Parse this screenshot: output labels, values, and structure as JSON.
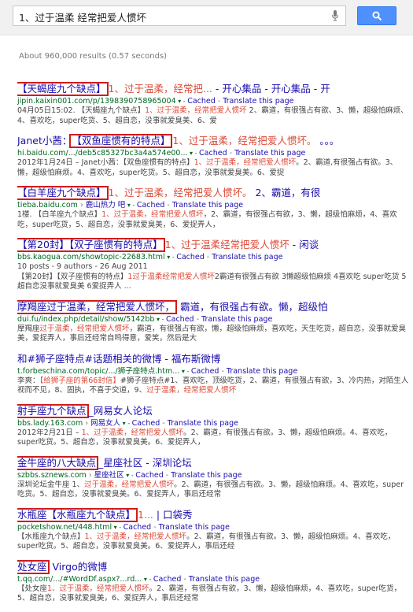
{
  "search": {
    "query": "1、过于温柔 经常把爱人惯坏"
  },
  "stats": "About 960,000 results (0.57 seconds)",
  "results": [
    {
      "title_hl": "【天蝎座九个缺点】",
      "title_red": "1、过于温柔，经常把...",
      "title_rest": " - 开心集品 - 开心集品 - 开",
      "url": "jipin.kaixin001.com/p/1398390758965004",
      "cached": "Cached",
      "translate": "Translate this page",
      "snippet": [
        [
          "04月05日15:02. 【天蝎座九个缺点】",
          "1、过于温柔，经常把爱人惯坏",
          " 2、霸道，有很强占有欲、3、懒，超级怕麻烦、4、喜欢吃，super吃货、5、超自恋，没事就爱臭美、6、爱"
        ]
      ]
    },
    {
      "title_pre": "Janet小茜：",
      "title_hl": "【双鱼座惯有的特点】",
      "title_red": "1、过于温柔，经常把爱人惯坏。",
      "title_rest": " 。。。",
      "url": "hi.baidu.com/.../deb5c85327bc3a4a574e00...",
      "cached": "Cached",
      "translate": "Translate this page",
      "snippet": [
        [
          "2012年1月24日 – Janet小茜：【双鱼座惯有的特点】",
          "1、过于温柔，经常把爱人惯坏",
          "。2、霸道,有很强占有欲。3、懒，超级怕麻烦。4、喜欢吃，super吃货。5、超自恋，没事就爱臭美。6、爱捉"
        ]
      ]
    },
    {
      "title_hl": "【白羊座九个缺点】",
      "title_red": "1、过于温柔，经常把爱人惯坏。",
      "title_rest": " 2、霸道，有很",
      "url": "tieba.baidu.com",
      "url_link": "鹿山热力 吧",
      "cached": "Cached",
      "translate": "Translate this page",
      "snippet": [
        [
          "1楼. 【白羊座九个缺点】",
          "1、过于温柔，经常把爱人惯坏",
          "，2、霸道，有很强占有欲，3、懒，超级怕麻烦，4、喜欢吃，super吃货，5、超自恋，没事就爱臭美，6、爱捉弄人，"
        ]
      ]
    },
    {
      "title_hl": "【第20封】【双子座惯有的特点】",
      "title_red": "1、过于温柔经常把爱人惯坏",
      "title_rest": " - 闲谈",
      "url": "bbs.kaogua.com/showtopic-22683.html",
      "cached": "Cached",
      "translate": "Translate this page",
      "meta": "10 posts - 9 authors - 26 Aug 2011",
      "snippet": [
        [
          "【第20封】【双子座惯有的特点】",
          "1过于温柔经常把爱人惯坏",
          "2霸道有很强占有欲 3懒超级怕麻烦 4喜欢吃 super吃货 5超自恋没事就爱臭美 6爱捉弄人 ..."
        ]
      ]
    },
    {
      "title_hl": "摩羯座过于温柔，经常把爱人惯坏，",
      "title_red": "",
      "title_rest": " 霸道，有很强占有欲。懒，超级怕",
      "url": "dui.fu/index.php/detail/show/5142bb",
      "cached": "Cached",
      "translate": "Translate this page",
      "snippet": [
        [
          "摩羯座",
          "过于温柔，经常把爱人惯坏",
          "，霸道，有很强占有欲，懒，超级怕麻烦，喜欢吃，天生吃货，超自恋，没事就爱臭美，爱捉弄人，事后还经常自鸣得意，爱笑，然后是大"
        ]
      ]
    },
    {
      "title_pre": "和#狮子座特点#话题相关的微博 - 福布斯微博",
      "url": "t.forbeschina.com/topic/.../狮子座特点.htm...",
      "cached": "Cached",
      "translate": "Translate this page",
      "snippet": [
        [
          "李爽：",
          "【给狮子座的第66封信】",
          "#狮子座特点#1、喜欢吃，顶级吃货，2、霸道，有很强占有欲，3、冷内热，对陌生人视而不见，8、固执，不喜于交道，9、",
          "过于温柔，经常把爱人惯坏"
        ]
      ]
    },
    {
      "title_hl": "射手座九个缺点",
      "title_rest": "_网易女人论坛",
      "url": "bbs.lady.163.com",
      "url_link": "网易女人",
      "cached": "Cached",
      "translate": "Translate this page",
      "snippet": [
        [
          "2012年2月21日 – ",
          "1、过于温柔，经常把爱人惯坏",
          "。2、霸道，有很强占有欲。3、懒，超级怕麻烦。4、喜欢吃，super吃货。5、超自恋，没事就爱臭美。6、爱捉弄人，"
        ]
      ]
    },
    {
      "title_hl": "金牛座的八大缺点",
      "title_rest": "_星座社区 - 深圳论坛",
      "url": "szbbs.sznews.com",
      "url_link": "星座社区",
      "cached": "Cached",
      "translate": "Translate this page",
      "snippet": [
        [
          "深圳论坛金牛座 1、",
          "过于温柔，经常把爱人惯坏",
          "。2、霸道，有很强占有欲。3、懒，超级怕麻烦。4、喜欢吃，super吃货。5、超自恋，没事就爱臭美。6、爱捉弄人，事后还经常"
        ]
      ]
    },
    {
      "title_hl": "水瓶座【水瓶座九个缺点】",
      "title_red": "1...",
      "title_rest": " | 口袋秀",
      "url": "pocketshow.net/448.html",
      "cached": "Cached",
      "translate": "Translate this page",
      "snippet": [
        [
          "【水瓶座九个缺点】",
          "1、过于温柔，经常把爱人惯坏",
          "。2、霸道，有很强占有欲。3、懒，超级怕麻烦。4、喜欢吃，super吃货。5、超自恋，没事就爱臭美。6、爱捉弄人，事后还经"
        ]
      ]
    },
    {
      "title_hl": "处女座",
      "title_rest": " Virgo的微博",
      "url": "t.qq.com/.../#WordDf.aspx?...rd...",
      "cached": "Cached",
      "translate": "Translate this page",
      "snippet": [
        [
          "【处女座",
          "1、过于温柔，经常把爱人惯坏",
          "。2、霸道，有很强占有欲，3、懒，超级怕麻烦，4、喜欢吃，super吃货，5、超自恋，没事就爱臭美，6、爱捉弄人，事后还经常"
        ]
      ]
    }
  ]
}
